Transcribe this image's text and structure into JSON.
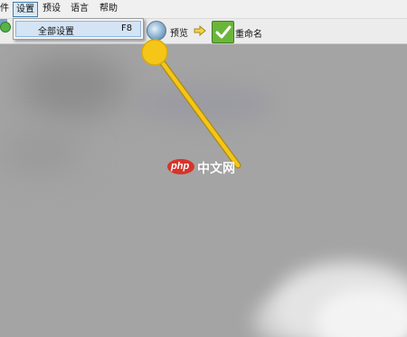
{
  "menubar": {
    "items": [
      "件",
      "设置",
      "预设",
      "语言",
      "帮助"
    ]
  },
  "dropdown": {
    "item_label": "全部设置",
    "item_shortcut": "F8"
  },
  "toolbar": {
    "preview_label": "预览",
    "rename_label": "重命名"
  },
  "watermark": {
    "logo_text": "php",
    "site_text": "中文网"
  },
  "colors": {
    "annotation": "#f5c518",
    "menu_highlight": "#dbe9f7",
    "check_green": "#6bb63a",
    "watermark_red": "#d7342a"
  }
}
